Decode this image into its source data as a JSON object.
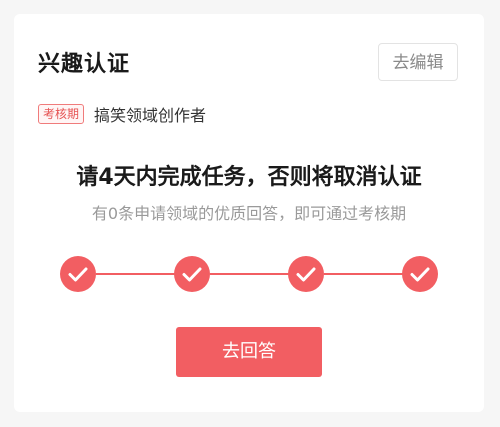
{
  "card": {
    "title": "兴趣认证",
    "edit_label": "去编辑",
    "tag": {
      "badge": "考核期",
      "field": "搞笑领域创作者"
    },
    "headline": "请4天内完成任务，否则将取消认证",
    "subline": "有0条申请领域的优质回答，即可通过考核期",
    "steps": [
      {
        "state": "done",
        "icon": "check-icon"
      },
      {
        "state": "done",
        "icon": "check-icon"
      },
      {
        "state": "done",
        "icon": "check-icon"
      },
      {
        "state": "done",
        "icon": "check-icon"
      }
    ],
    "cta_label": "去回答"
  },
  "colors": {
    "accent": "#f25e62",
    "background": "#f6f6f6",
    "card": "#ffffff",
    "badge_border": "#f07b7b",
    "muted_text": "#9a9a9a"
  }
}
